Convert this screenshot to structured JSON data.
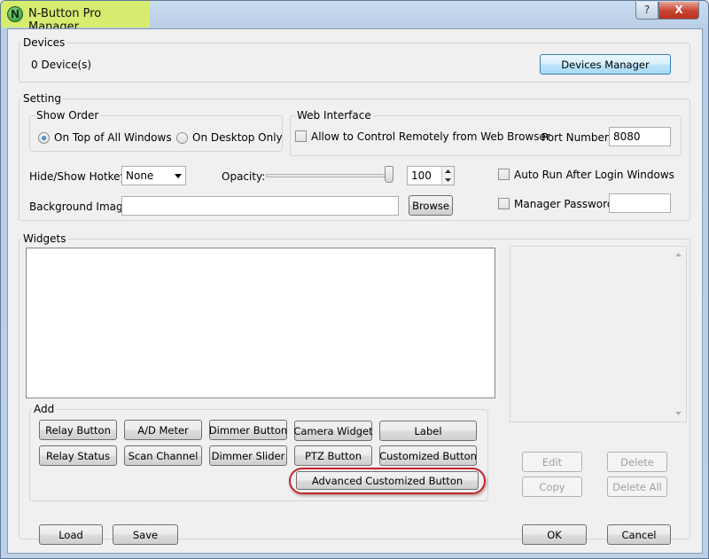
{
  "window": {
    "title": "N-Button Pro Manager",
    "app_icon_letter": "N",
    "help_glyph": "?",
    "close_glyph": "X"
  },
  "devices": {
    "group_label": "Devices",
    "count_text": "0 Device(s)",
    "manager_button": "Devices Manager"
  },
  "setting": {
    "group_label": "Setting",
    "show_order": {
      "group_label": "Show Order",
      "options": [
        {
          "label": "On Top of All Windows",
          "checked": true
        },
        {
          "label": "On Desktop Only",
          "checked": false
        }
      ]
    },
    "web_interface": {
      "group_label": "Web Interface",
      "allow_remote_label": "Allow to Control Remotely from Web Browser",
      "allow_remote_checked": false,
      "port_label": "Port Number:",
      "port_value": "8080"
    },
    "hotkey_label": "Hide/Show Hotkey:",
    "hotkey_value": "None",
    "opacity_label": "Opacity:",
    "opacity_value": "100",
    "opacity_level_percent": 100,
    "auto_run_label": "Auto Run After Login Windows",
    "auto_run_checked": false,
    "background_label": "Background Image:",
    "background_value": "",
    "browse_button": "Browse",
    "manager_password_label": "Manager Password",
    "manager_password_checked": false,
    "manager_password_value": ""
  },
  "widgets": {
    "group_label": "Widgets",
    "add": {
      "group_label": "Add",
      "row1": [
        "Relay Button",
        "A/D Meter",
        "Dimmer Button",
        "Camera Widget",
        "Label"
      ],
      "row2": [
        "Relay Status",
        "Scan Channel",
        "Dimmer Slider",
        "PTZ Button",
        "Customized Button"
      ],
      "advanced_button": "Advanced Customized Button"
    },
    "edit_button": "Edit",
    "delete_button": "Delete",
    "copy_button": "Copy",
    "delete_all_button": "Delete All"
  },
  "footer": {
    "load_button": "Load",
    "save_button": "Save",
    "ok_button": "OK",
    "cancel_button": "Cancel"
  },
  "colors": {
    "title_highlight": "#d6ec6e",
    "annotation_ring": "#c0262b",
    "close_button": "#c9432e"
  }
}
